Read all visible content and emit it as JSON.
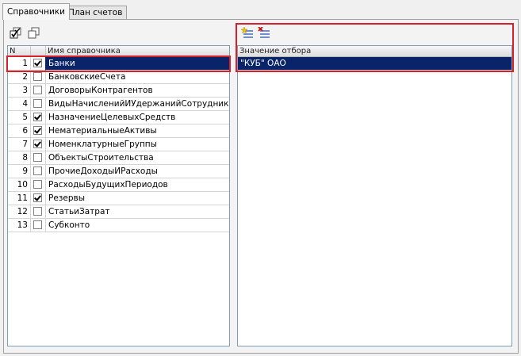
{
  "tabs": [
    {
      "label": "Справочники",
      "active": true
    },
    {
      "label": "План счетов",
      "active": false
    }
  ],
  "left_toolbar": {
    "buttons": [
      {
        "icon": "check-all-icon"
      },
      {
        "icon": "copy-windows-icon"
      }
    ]
  },
  "right_toolbar": {
    "buttons": [
      {
        "icon": "add-filter-icon"
      },
      {
        "icon": "remove-filter-icon"
      }
    ]
  },
  "catalog_table": {
    "columns": {
      "n": "N",
      "name": "Имя справочника"
    },
    "selected_index": 0,
    "rows": [
      {
        "n": "1",
        "checked": true,
        "name": "Банки"
      },
      {
        "n": "2",
        "checked": false,
        "name": "БанковскиеСчета"
      },
      {
        "n": "3",
        "checked": false,
        "name": "ДоговорыКонтрагентов"
      },
      {
        "n": "4",
        "checked": false,
        "name": "ВидыНачисленийИУдержанийСотрудников"
      },
      {
        "n": "5",
        "checked": true,
        "name": "НазначениеЦелевыхСредств"
      },
      {
        "n": "6",
        "checked": true,
        "name": "НематериальныеАктивы"
      },
      {
        "n": "7",
        "checked": true,
        "name": "НоменклатурныеГруппы"
      },
      {
        "n": "8",
        "checked": false,
        "name": "ОбъектыСтроительства"
      },
      {
        "n": "9",
        "checked": false,
        "name": "ПрочиеДоходыИРасходы"
      },
      {
        "n": "10",
        "checked": false,
        "name": "РасходыБудущихПериодов"
      },
      {
        "n": "11",
        "checked": true,
        "name": "Резервы"
      },
      {
        "n": "12",
        "checked": false,
        "name": "СтатьиЗатрат"
      },
      {
        "n": "13",
        "checked": false,
        "name": "Субконто"
      }
    ]
  },
  "filter_table": {
    "columns": {
      "value": "Значение отбора"
    },
    "rows": [
      {
        "value": "\"КУБ\" ОАО",
        "selected": true
      }
    ]
  },
  "colors": {
    "highlight_box": "#d6202a",
    "selection": "#0a246a"
  }
}
